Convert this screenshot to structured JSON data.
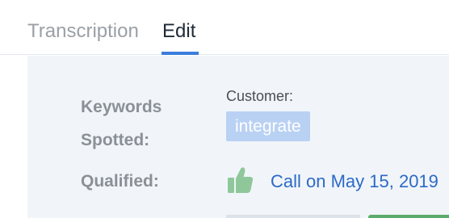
{
  "tabs": [
    {
      "label": "Transcription",
      "active": false
    },
    {
      "label": "Edit",
      "active": true
    }
  ],
  "details": {
    "keywords_label": "Keywords Spotted:",
    "speaker_label": "Customer:",
    "keywords": [
      "integrate"
    ],
    "qualified_label": "Qualified:",
    "qualified_icon": "thumbs-up-icon",
    "call_link": "Call on May 15, 2019"
  },
  "colors": {
    "accent": "#3b7ddd",
    "keyword_tag_bg": "#b9d1f3",
    "thumbs_up": "#8fc79a",
    "link": "#2c6ac8",
    "panel_bg": "#f1f5f9"
  }
}
